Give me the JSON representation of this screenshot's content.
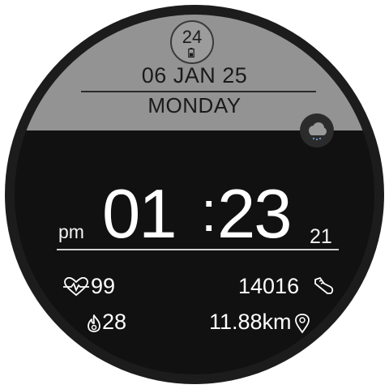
{
  "battery": {
    "level": "24",
    "icon": "battery-icon"
  },
  "date": {
    "text": "06 JAN 25",
    "day": "MONDAY"
  },
  "weather": {
    "icon": "rain-cloud-icon"
  },
  "time": {
    "ampm": "pm",
    "hours": "01",
    "colon": ":",
    "minutes": "23",
    "seconds": "21"
  },
  "stats": {
    "heart_rate": {
      "value": "99",
      "icon": "heart-rate-icon"
    },
    "steps": {
      "value": "14016",
      "icon": "shoe-icon"
    },
    "calories": {
      "value": "28",
      "icon": "flame-icon"
    },
    "distance": {
      "value": "11.88km",
      "icon": "location-pin-icon"
    }
  },
  "colors": {
    "band": "#939393",
    "face": "#111111",
    "bezel": "#1c1c1c",
    "text_light": "#ffffff",
    "text_dark": "#1a1a1a"
  }
}
